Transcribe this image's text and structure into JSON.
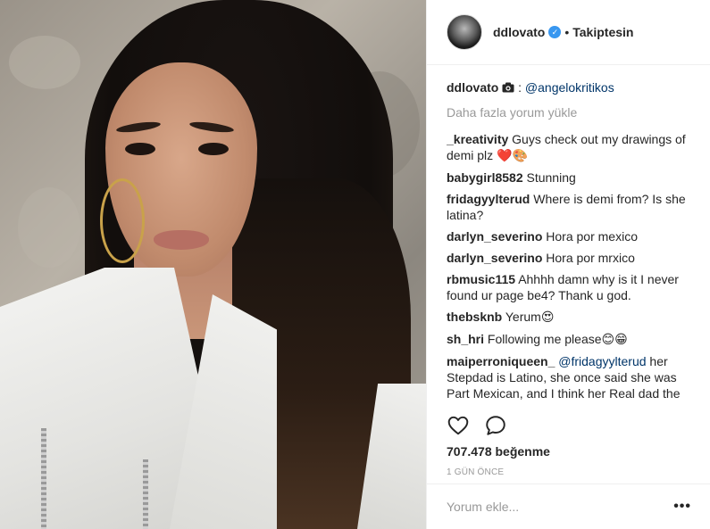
{
  "post": {
    "image_alt": "",
    "author": "ddlovato",
    "verified": true,
    "follow_status": "Takiptesin",
    "separator": "•"
  },
  "caption": {
    "user": "ddlovato",
    "camera_icon": "camera-icon",
    "colon": ":",
    "mention": "@angelokritikos"
  },
  "load_more": "Daha fazla yorum yükle",
  "comments": [
    {
      "user": "_kreativity",
      "text": "Guys check out my drawings of demi plz ",
      "emoji": "❤️🎨"
    },
    {
      "user": "babygirl8582",
      "text": "Stunning",
      "emoji": ""
    },
    {
      "user": "fridagyylterud",
      "text": "Where is demi from? Is she latina?",
      "emoji": ""
    },
    {
      "user": "darlyn_severino",
      "text": "Hora por mexico",
      "emoji": ""
    },
    {
      "user": "darlyn_severino",
      "text": "Hora por mrxico",
      "emoji": ""
    },
    {
      "user": "rbmusic115",
      "text": "Ahhhh damn why is it I never found ur page be4? Thank u god.",
      "emoji": ""
    },
    {
      "user": "thebsknb",
      "text": "Yerum",
      "emoji": "😍"
    },
    {
      "user": "sh_hri",
      "text": "Following me please",
      "emoji": "😊😁"
    },
    {
      "user": "maiperroniqueen_",
      "mention": "@fridagyylterud",
      "text": " her Stepdad is Latino, she once said she was Part Mexican, and I think her Real dad the one who passed away I believed he was",
      "emoji": ""
    }
  ],
  "actions": {
    "like_icon": "heart-icon",
    "comment_icon": "comment-icon"
  },
  "likes": "707.478 beğenme",
  "timestamp": "1 GÜN ÖNCE",
  "add_comment": {
    "placeholder": "Yorum ekle...",
    "more_label": "•••"
  }
}
